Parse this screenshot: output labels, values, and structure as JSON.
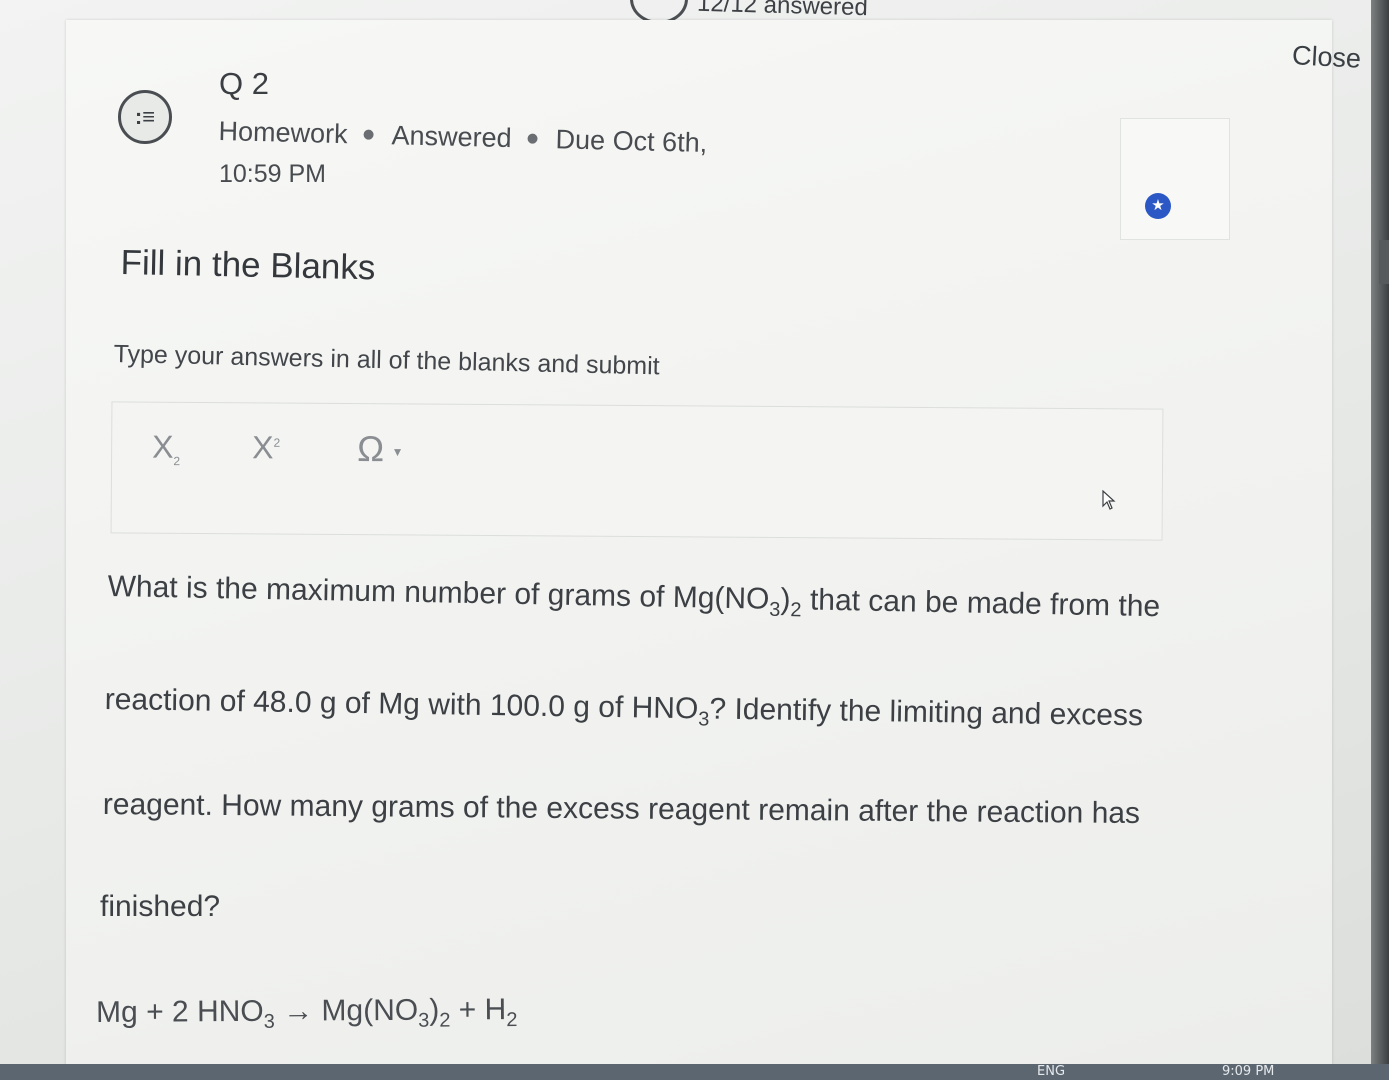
{
  "header": {
    "answered_count": "12/12 answered",
    "close_label": "Close"
  },
  "question": {
    "number": "Q 2",
    "type": "Homework",
    "status": "Answered",
    "due_label": "Due Oct 6th,",
    "due_time": "10:59 PM",
    "icon": "list-bubble-icon",
    "star_icon": "star-icon"
  },
  "section_title": "Fill in the Blanks",
  "instructions": "Type your answers in all of the blanks and submit",
  "toolbar": {
    "subscript_label": "X",
    "subscript_mark": "2",
    "superscript_label": "X",
    "superscript_mark": "2",
    "special_char_label": "Ω",
    "special_char_caret": "▾"
  },
  "question_text": {
    "line1_a": "What is the maximum number of grams of Mg(NO",
    "line1_sub1": "3",
    "line1_b": ")",
    "line1_sub2": "2",
    "line1_c": " that can be made from the",
    "line2_a": "reaction of 48.0 g of Mg with 100.0 g of HNO",
    "line2_sub": "3",
    "line2_b": "? Identify the limiting and excess",
    "line3": "reagent.  How many grams of the excess reagent remain after the reaction has",
    "line4": "finished?"
  },
  "equation": {
    "part1": "Mg + 2 HNO",
    "sub1": "3",
    "arrow": " → ",
    "part2": "Mg(NO",
    "sub2": "3",
    "part3": ")",
    "sub3": "2",
    "part4": " + H",
    "sub4": "2"
  },
  "taskbar": {
    "lang": "ENG",
    "time": "9:09 PM"
  }
}
